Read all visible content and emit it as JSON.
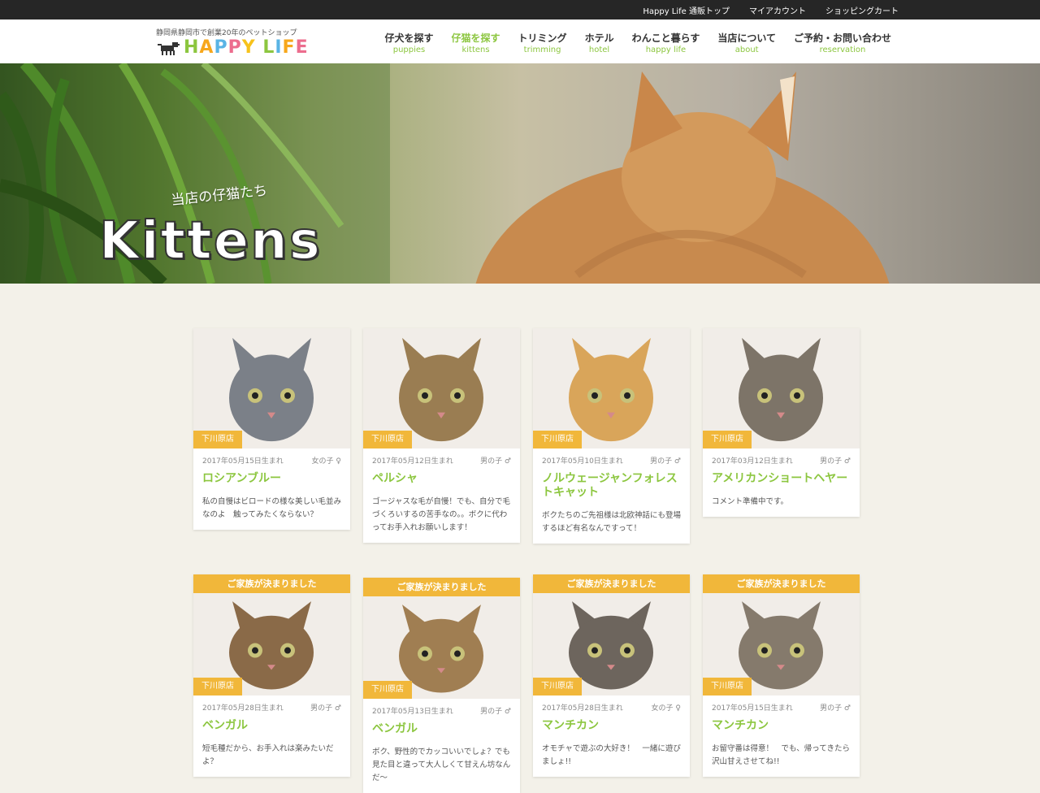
{
  "topbar": {
    "links": [
      "Happy Life 通販トップ",
      "マイアカウント",
      "ショッピングカート"
    ]
  },
  "logo": {
    "tagline": "静岡県静岡市で創業20年のペットショップ",
    "word": [
      "H",
      "A",
      "P",
      "P",
      "Y",
      " ",
      "L",
      "I",
      "F",
      "E"
    ]
  },
  "nav": [
    {
      "jp": "仔犬を探す",
      "en": "puppies"
    },
    {
      "jp": "仔猫を探す",
      "en": "kittens",
      "active": true
    },
    {
      "jp": "トリミング",
      "en": "trimming"
    },
    {
      "jp": "ホテル",
      "en": "hotel"
    },
    {
      "jp": "わんこと暮らす",
      "en": "happy life"
    },
    {
      "jp": "当店について",
      "en": "about"
    },
    {
      "jp": "ご予約・お問い合わせ",
      "en": "reservation"
    }
  ],
  "hero": {
    "subtitle": "当店の仔猫たち",
    "title": "Kittens"
  },
  "cards": [
    {
      "store": "下川原店",
      "birth": "2017年05月15日生まれ",
      "sex": "女の子 ♀",
      "name": "ロシアンブルー",
      "desc": "私の自慢はビロードの様な美しい毛並みなのよ　触ってみたくならない？",
      "coat": "#7b8088"
    },
    {
      "store": "下川原店",
      "birth": "2017年05月12日生まれ",
      "sex": "男の子 ♂",
      "name": "ペルシャ",
      "desc": "ゴージャスな毛が自慢！でも、自分で毛づくろいするの苦手なの。。ボクに代わってお手入れお願いします！",
      "coat": "#9a7d52"
    },
    {
      "store": "下川原店",
      "birth": "2017年05月10日生まれ",
      "sex": "男の子 ♂",
      "name": "ノルウェージャンフォレストキャット",
      "desc": "ボクたちのご先祖様は北欧神話にも登場するほど有名なんですって！",
      "coat": "#d9a55a"
    },
    {
      "store": "下川原店",
      "birth": "2017年03月12日生まれ",
      "sex": "男の子 ♂",
      "name": "アメリカンショートヘヤー",
      "desc": "コメント準備中です。",
      "coat": "#7d7468"
    },
    {
      "banner": "ご家族が決まりました",
      "store": "下川原店",
      "birth": "2017年05月28日生まれ",
      "sex": "男の子 ♂",
      "name": "ベンガル",
      "desc": "短毛種だから、お手入れは楽みたいだよ？",
      "coat": "#8a6a48"
    },
    {
      "banner": "ご家族が決まりました",
      "store": "下川原店",
      "birth": "2017年05月13日生まれ",
      "sex": "男の子 ♂",
      "name": "ベンガル",
      "desc": "ボク、野性的でカッコいいでしょ？でも見た目と違って大人しくて甘えん坊なんだ〜",
      "coat": "#a07e52"
    },
    {
      "banner": "ご家族が決まりました",
      "store": "下川原店",
      "birth": "2017年05月28日生まれ",
      "sex": "女の子 ♀",
      "name": "マンチカン",
      "desc": "オモチャで遊ぶの大好き！　一緒に遊びましょ!!",
      "coat": "#6d655d"
    },
    {
      "banner": "ご家族が決まりました",
      "store": "下川原店",
      "birth": "2017年05月15日生まれ",
      "sex": "男の子 ♂",
      "name": "マンチカン",
      "desc": "お留守番は得意！　でも、帰ってきたら沢山甘えさせてね!!",
      "coat": "#857a6c"
    }
  ]
}
